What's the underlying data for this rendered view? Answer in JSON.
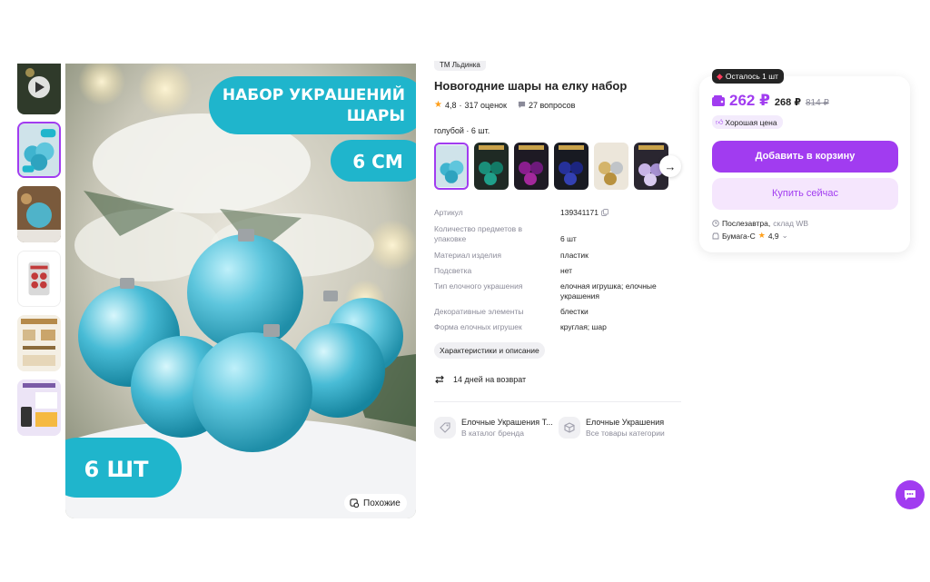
{
  "gallery": {
    "image_text": {
      "headline_1": "НАБОР УКРАШЕНИЙ",
      "headline_2": "ШАРЫ",
      "size": "6 СМ",
      "count": "6 ШТ"
    },
    "similar_label": "Похожие"
  },
  "product": {
    "brand_tag": "ТМ Льдинка",
    "title": "Новогодние шары на елку набор",
    "rating": "4,8",
    "reviews": "317 оценок",
    "questions": "27 вопросов",
    "variant_label": "голубой · 6 шт.",
    "specs": [
      {
        "key": "Артикул",
        "value": "139341171"
      },
      {
        "key": "Количество предметов в упаковке",
        "value": "6 шт"
      },
      {
        "key": "Материал изделия",
        "value": "пластик"
      },
      {
        "key": "Подсветка",
        "value": "нет"
      },
      {
        "key": "Тип елочного украшения",
        "value": "елочная игрушка; елочные украшения"
      },
      {
        "key": "Декоративные элементы",
        "value": "блестки"
      },
      {
        "key": "Форма елочных игрушек",
        "value": "круглая; шар"
      }
    ],
    "characteristics_button": "Характеристики и описание",
    "returns": "14 дней на возврат",
    "brand_link": {
      "name": "Елочные Украшения Т...",
      "sub": "В каталог бренда"
    },
    "category_link": {
      "name": "Елочные Украшения",
      "sub": "Все товары категории"
    }
  },
  "buy_box": {
    "stock_badge": "Осталось 1 шт",
    "price_wallet": "262 ₽",
    "price": "268 ₽",
    "price_old": "814 ₽",
    "good_price": "Хорошая цена",
    "add_to_cart": "Добавить в корзину",
    "buy_now": "Купить сейчас",
    "delivery_when": "Послезавтра,",
    "delivery_where": "склад WB",
    "seller": "Бумага-С",
    "seller_rating": "4,9"
  },
  "colors": {
    "accent": "#a13cf0",
    "accent_light": "#f5e6fd",
    "star": "#ff9f1a",
    "teal_banner": "#1fb5cc"
  }
}
